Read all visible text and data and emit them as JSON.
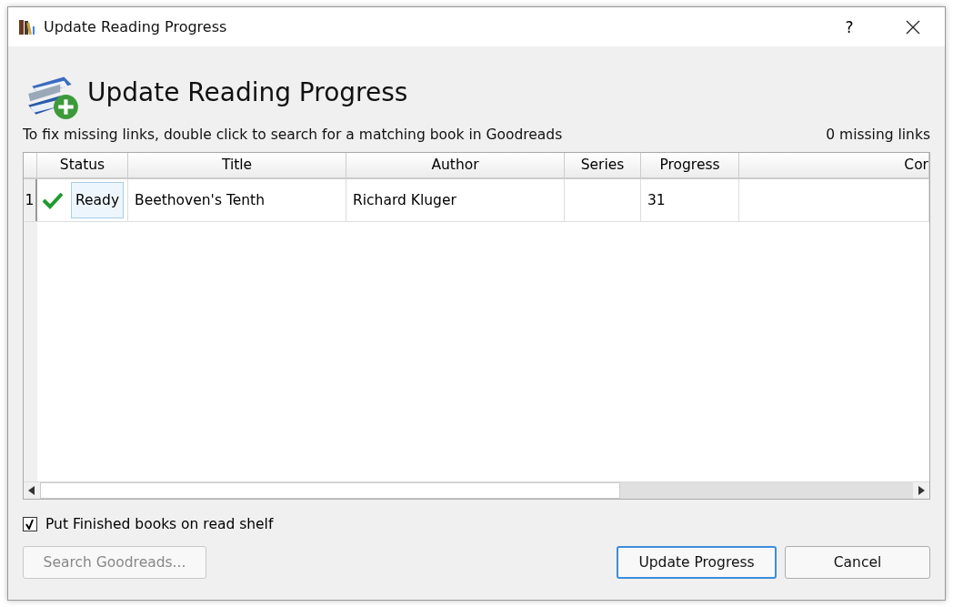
{
  "window": {
    "title": "Update Reading Progress",
    "help": "?"
  },
  "header": {
    "title": "Update Reading Progress"
  },
  "instructions": "To fix missing links, double click to search for a matching book in Goodreads",
  "missing_count": "0 missing links",
  "table": {
    "columns": [
      {
        "label": "Status",
        "kind": "status"
      },
      {
        "label": "Title",
        "kind": "title"
      },
      {
        "label": "Author",
        "kind": "author"
      },
      {
        "label": "Series",
        "kind": "series"
      },
      {
        "label": "Progress",
        "kind": "progress"
      },
      {
        "label": "Cor",
        "kind": "cut"
      }
    ],
    "rows": [
      {
        "number": "1",
        "status_ok": true,
        "status_focused": true,
        "cells": [
          "Ready",
          "Beethoven's Tenth",
          "Richard Kluger",
          "",
          "31",
          ""
        ]
      }
    ]
  },
  "checkbox": {
    "label": "Put Finished books on read shelf",
    "checked": true
  },
  "buttons": [
    {
      "label": "Search Goodreads...",
      "disabled": true,
      "default": false,
      "kind": "left"
    },
    {
      "label": "Update Progress",
      "disabled": false,
      "default": true,
      "kind": "right"
    },
    {
      "label": "Cancel",
      "disabled": false,
      "default": false,
      "kind": "right"
    }
  ]
}
